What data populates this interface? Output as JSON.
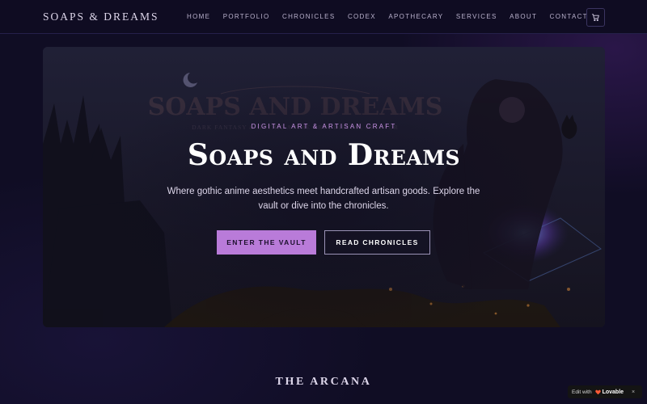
{
  "header": {
    "logo": "SOAPS & DREAMS",
    "nav": [
      "HOME",
      "PORTFOLIO",
      "CHRONICLES",
      "CODEX",
      "APOTHECARY",
      "SERVICES",
      "ABOUT",
      "CONTACT"
    ],
    "cart_icon": "shopping-cart-icon"
  },
  "hero": {
    "eyebrow": "DIGITAL ART & ARTISAN CRAFT",
    "title": "Soaps and Dreams",
    "description": "Where gothic anime aesthetics meet handcrafted artisan goods. Explore the vault or dive into the chronicles.",
    "primary_button": "ENTER THE VAULT",
    "secondary_button": "READ CHRONICLES",
    "image_watermark_title": "SOAPS AND DREAMS",
    "image_watermark_subtitle": "DARK FANTASY & GOTHIC ANIME ART | DIGITAL CREATOR"
  },
  "section": {
    "title": "THE ARCANA"
  },
  "badge": {
    "edit_with": "Edit with",
    "brand": "Lovable",
    "close": "×"
  },
  "colors": {
    "background": "#100d24",
    "accent": "#b97bd9",
    "eyebrow": "#c993e6"
  }
}
